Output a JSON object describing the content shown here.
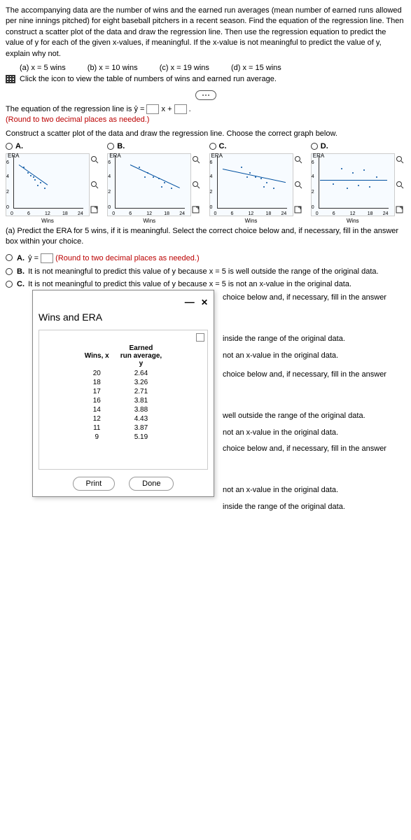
{
  "problem": {
    "intro": "The accompanying data are the number of wins and the earned run averages (mean number of earned runs allowed per nine innings pitched) for eight baseball pitchers in a recent season. Find the equation of the regression line. Then construct a scatter plot of the data and draw the regression line. Then use the regression equation to predict the value of y for each of the given x-values, if meaningful. If the x-value is not meaningful to predict the value of y, explain why not.",
    "sub_a": "(a) x = 5 wins",
    "sub_b": "(b) x = 10 wins",
    "sub_c": "(c) x = 19 wins",
    "sub_d": "(d) x = 15 wins",
    "click_icon": "Click the icon to view the table of numbers of wins and earned run average."
  },
  "equation": {
    "line1_pre": "The equation of the regression line is ŷ = ",
    "line1_mid": "x + ",
    "line1_post": ".",
    "round_note": "(Round to two decimal places as needed.)"
  },
  "scatter_prompt": "Construct a scatter plot of the data and draw the regression line. Choose the correct graph below.",
  "graphs": {
    "a": "A.",
    "b": "B.",
    "c": "C.",
    "d": "D.",
    "y_label": "ERA",
    "x_label": "Wins",
    "y_ticks": [
      "0",
      "2",
      "4",
      "6"
    ],
    "x_ticks": [
      "0",
      "6",
      "12",
      "18",
      "24"
    ]
  },
  "part_a": {
    "text": "(a) Predict the ERA for 5 wins, if it is meaningful. Select the correct choice below and, if necessary, fill in the answer box within your choice.",
    "opt_a_pre": "ŷ = ",
    "opt_a_post": " (Round to two decimal places as needed.)",
    "opt_b": "It is not meaningful to predict this value of y because x = 5 is well outside the range of the original data.",
    "opt_c": "It is not meaningful to predict this value of y because x = 5 is not an x-value in the original data."
  },
  "fragments": {
    "f1": "choice below and, if necessary, fill in the answer",
    "f2a": "inside the range of the original data.",
    "f2b": "not an x-value in the original data.",
    "f3": "choice below and, if necessary, fill in the answer",
    "f4a": "well outside the range of the original data.",
    "f4b": "not an x-value in the original data.",
    "f5": "choice below and, if necessary, fill in the answer",
    "f6a": "not an x-value in the original data.",
    "f6b": "inside the range of the original data."
  },
  "modal": {
    "title": "Wins and ERA",
    "col1": "Wins, x",
    "col2_a": "Earned",
    "col2_b": "run average,",
    "col2_c": "y",
    "rows": [
      {
        "w": "20",
        "e": "2.64"
      },
      {
        "w": "18",
        "e": "3.26"
      },
      {
        "w": "17",
        "e": "2.71"
      },
      {
        "w": "16",
        "e": "3.81"
      },
      {
        "w": "14",
        "e": "3.88"
      },
      {
        "w": "12",
        "e": "4.43"
      },
      {
        "w": "11",
        "e": "3.87"
      },
      {
        "w": "9",
        "e": "5.19"
      }
    ],
    "print": "Print",
    "done": "Done"
  },
  "labels": {
    "A": "A.",
    "B": "B.",
    "C": "C."
  },
  "chart_data": [
    {
      "type": "scatter",
      "option": "A",
      "xlabel": "Wins",
      "ylabel": "ERA",
      "xlim": [
        0,
        24
      ],
      "ylim": [
        0,
        6
      ],
      "points": [
        [
          4,
          5.2
        ],
        [
          6,
          4.4
        ],
        [
          7,
          3.9
        ],
        [
          8,
          3.9
        ],
        [
          8,
          3.8
        ],
        [
          9,
          2.7
        ],
        [
          10,
          3.3
        ],
        [
          12,
          2.6
        ]
      ],
      "regression": {
        "slope_sign": "negative",
        "approx_from": [
          2,
          5.5
        ],
        "approx_to": [
          14,
          2.0
        ]
      }
    },
    {
      "type": "scatter",
      "option": "B",
      "xlabel": "Wins",
      "ylabel": "ERA",
      "xlim": [
        0,
        24
      ],
      "ylim": [
        0,
        6
      ],
      "points": [
        [
          9,
          5.2
        ],
        [
          11,
          3.9
        ],
        [
          12,
          4.4
        ],
        [
          14,
          3.9
        ],
        [
          16,
          3.8
        ],
        [
          17,
          2.7
        ],
        [
          18,
          3.3
        ],
        [
          20,
          2.6
        ]
      ],
      "regression": {
        "slope_sign": "negative",
        "approx_from": [
          6,
          5.5
        ],
        "approx_to": [
          24,
          2.0
        ]
      }
    },
    {
      "type": "scatter",
      "option": "C",
      "xlabel": "Wins",
      "ylabel": "ERA",
      "xlim": [
        0,
        24
      ],
      "ylim": [
        0,
        6
      ],
      "points": [
        [
          9,
          5.2
        ],
        [
          11,
          3.9
        ],
        [
          12,
          4.4
        ],
        [
          14,
          3.9
        ],
        [
          16,
          3.8
        ],
        [
          17,
          2.7
        ],
        [
          18,
          3.3
        ],
        [
          20,
          2.6
        ]
      ],
      "regression": {
        "slope_sign": "negative",
        "approx_from": [
          2,
          5.0
        ],
        "approx_to": [
          24,
          3.0
        ]
      }
    },
    {
      "type": "scatter",
      "option": "D",
      "xlabel": "Wins",
      "ylabel": "ERA",
      "xlim": [
        0,
        24
      ],
      "ylim": [
        0,
        6
      ],
      "points": [
        [
          6,
          3.0
        ],
        [
          9,
          5.0
        ],
        [
          11,
          2.5
        ],
        [
          13,
          4.5
        ],
        [
          15,
          3.0
        ],
        [
          17,
          5.0
        ],
        [
          19,
          3.0
        ],
        [
          21,
          4.0
        ]
      ],
      "regression": {
        "slope_sign": "flat",
        "approx_from": [
          0,
          3.6
        ],
        "approx_to": [
          24,
          3.6
        ]
      }
    }
  ]
}
